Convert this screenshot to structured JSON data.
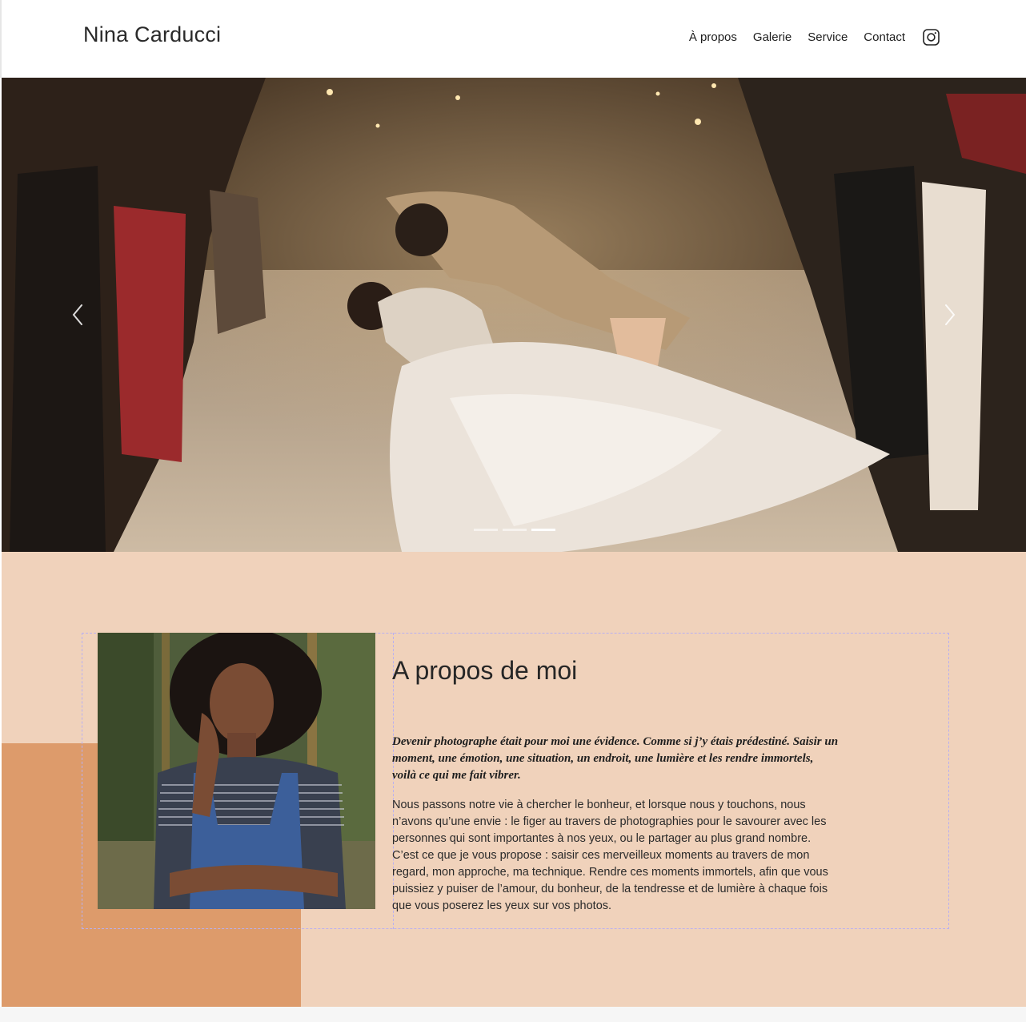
{
  "header": {
    "brand": "Nina Carducci",
    "nav": [
      "À propos",
      "Galerie",
      "Service",
      "Contact"
    ],
    "social_icon": "instagram-icon"
  },
  "hero": {
    "slides_total": 3,
    "active_slide": 3,
    "prev_icon": "chevron-left-icon",
    "next_icon": "chevron-right-icon"
  },
  "about": {
    "title": "A propos de moi",
    "quote": "Devenir photographe était pour moi une évidence. Comme si j’y étais prédestiné. Saisir un moment, une émotion, une situation, un endroit, une lumière et les rendre immortels, voilà ce qui me fait vibrer.",
    "body": "Nous passons notre vie à chercher le bonheur, et lorsque nous y touchons, nous n’avons qu’une envie : le figer au travers de photographies pour le savourer avec les personnes qui sont importantes à nos yeux, ou le partager au plus grand nombre. C’est ce que je vous propose : saisir ces merveilleux moments au travers de mon regard, mon approche, ma technique. Rendre ces moments immortels, afin que vous puissiez y puiser de l’amour, du bonheur, de la tendresse et de lumière à chaque fois que vous poserez les yeux sur vos photos."
  },
  "colors": {
    "about_bg": "#f0d2bb",
    "accent_block": "#dd9b6b",
    "dashed_outline": "#b9b0f0"
  }
}
